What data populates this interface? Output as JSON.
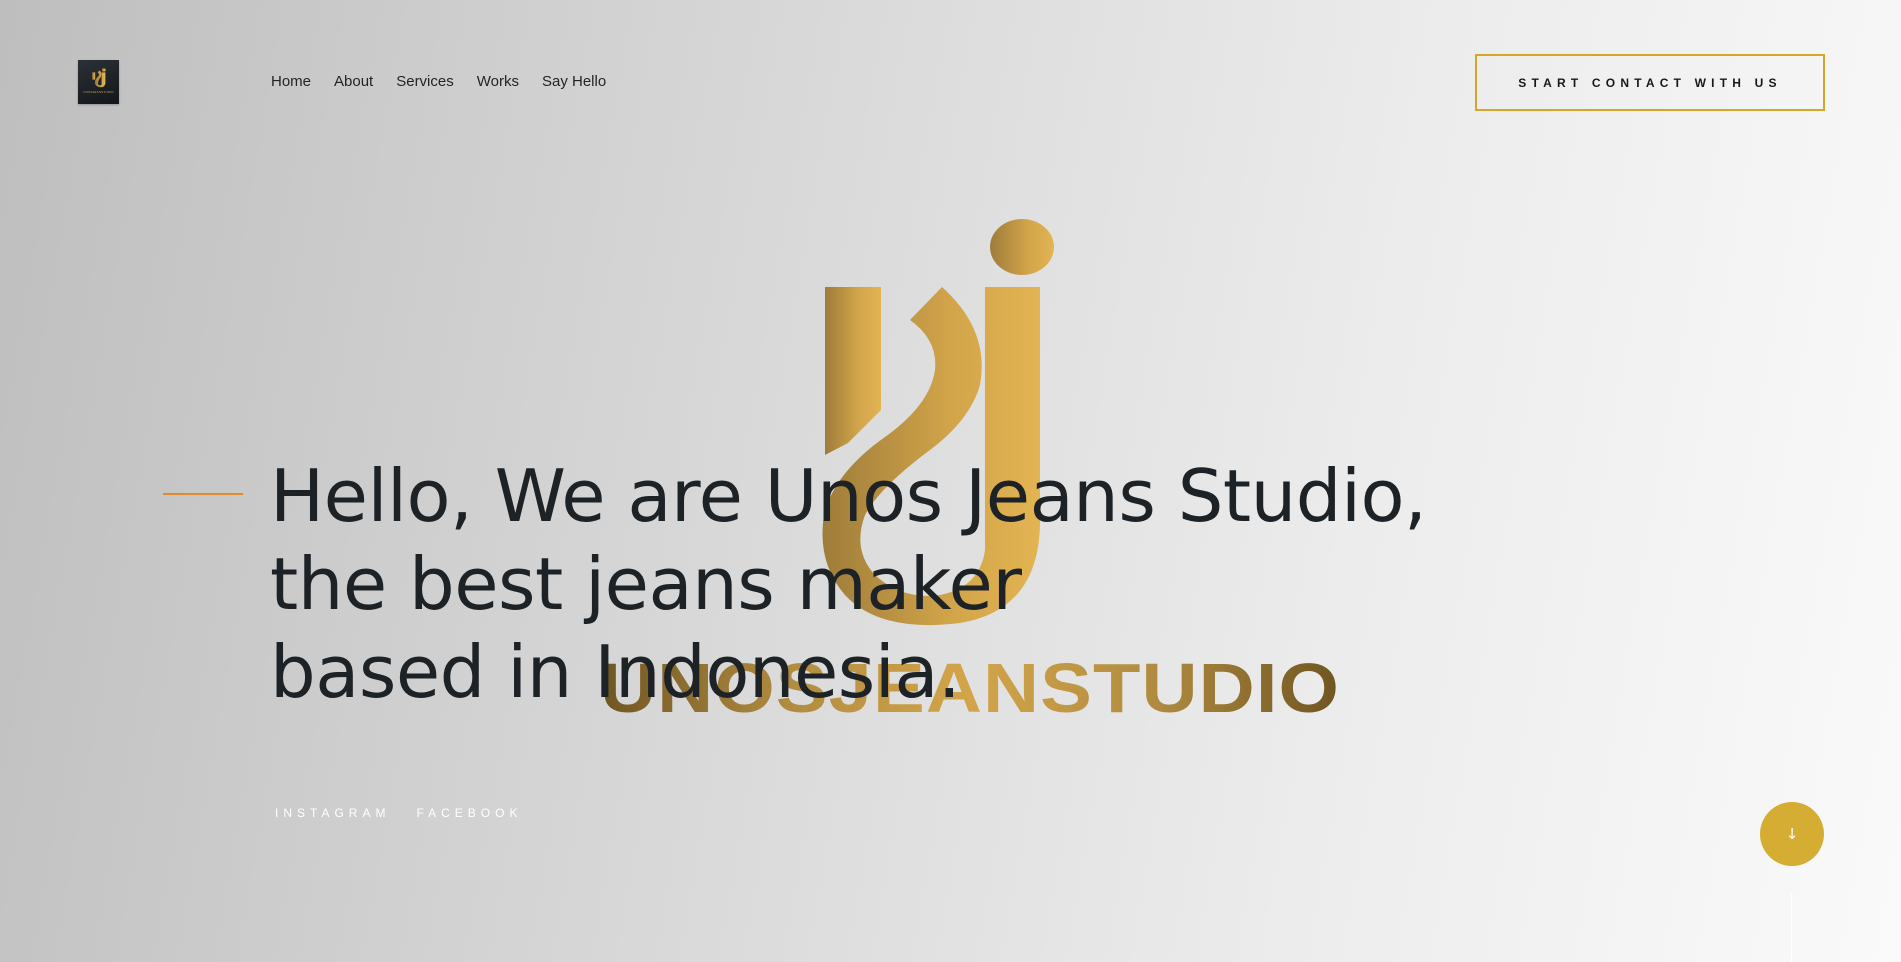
{
  "brand": {
    "logo_icon": "unos-jeans-studio-logo",
    "gold": "#d4a72c",
    "wordmark": "UNOSJEANSTUDIO"
  },
  "nav": {
    "items": [
      {
        "label": "Home"
      },
      {
        "label": "About"
      },
      {
        "label": "Services"
      },
      {
        "label": "Works"
      },
      {
        "label": "Say Hello"
      }
    ]
  },
  "header": {
    "cta_label": "START CONTACT WITH US"
  },
  "hero": {
    "line1": "Hello, We are Unos Jeans Studio,",
    "line2": "the best jeans maker",
    "line3": "based in Indonesia.",
    "accent_color": "#e08a2a"
  },
  "social": {
    "links": [
      {
        "label": "INSTAGRAM"
      },
      {
        "label": "FACEBOOK"
      }
    ]
  },
  "scroll": {
    "icon": "arrow-down-icon",
    "glyph": "↓",
    "color": "#d6ad33"
  }
}
